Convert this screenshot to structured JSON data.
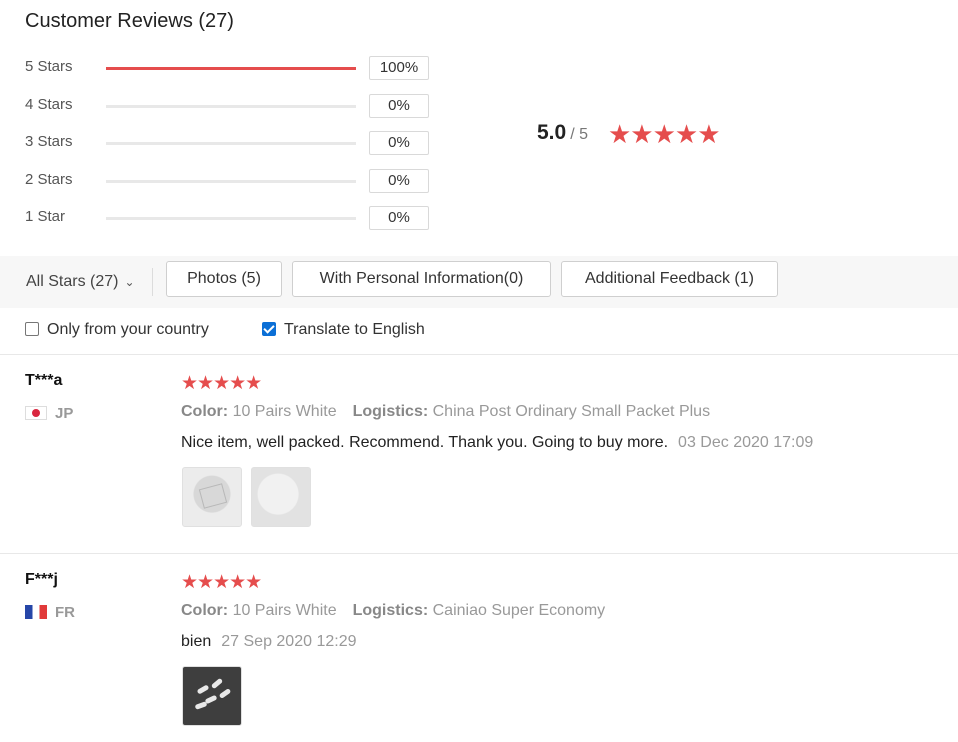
{
  "header": {
    "title": "Customer Reviews (27)"
  },
  "histogram": [
    {
      "label": "5 Stars",
      "percent": "100%",
      "fraction": 1.0
    },
    {
      "label": "4 Stars",
      "percent": "0%",
      "fraction": 0
    },
    {
      "label": "3 Stars",
      "percent": "0%",
      "fraction": 0
    },
    {
      "label": "2 Stars",
      "percent": "0%",
      "fraction": 0
    },
    {
      "label": "1 Star",
      "percent": "0%",
      "fraction": 0
    }
  ],
  "summary": {
    "average": "5.0",
    "out_of": "/ 5",
    "stars": "★★★★★",
    "star_count": 5
  },
  "filters": {
    "dropdown_label": "All Stars (27)",
    "dropdown_arrow": "⌄",
    "buttons": [
      "Photos (5)",
      "With Personal Information(0)",
      "Additional Feedback (1)"
    ]
  },
  "options": {
    "only_country": {
      "label": "Only from your country",
      "checked": false
    },
    "translate": {
      "label": "Translate to English",
      "checked": true
    }
  },
  "reviews": [
    {
      "user": "T***a",
      "country": "JP",
      "flag": "flag-jp",
      "stars": "★★★★★",
      "color_label": "Color:",
      "color_value": "10 Pairs White",
      "logistics_label": "Logistics:",
      "logistics_value": "China Post Ordinary Small Packet Plus",
      "text": "Nice item, well packed. Recommend. Thank you. Going to buy more.",
      "date": "03 Dec 2020 17:09"
    },
    {
      "user": "F***j",
      "country": "FR",
      "flag": "flag-fr",
      "stars": "★★★★★",
      "color_label": "Color:",
      "color_value": "10 Pairs White",
      "logistics_label": "Logistics:",
      "logistics_value": "Cainiao Super Economy",
      "text": "bien",
      "date": "27 Sep 2020 12:29"
    }
  ],
  "colors": {
    "accent": "#e54d4d",
    "checkbox": "#0b6fd6"
  }
}
